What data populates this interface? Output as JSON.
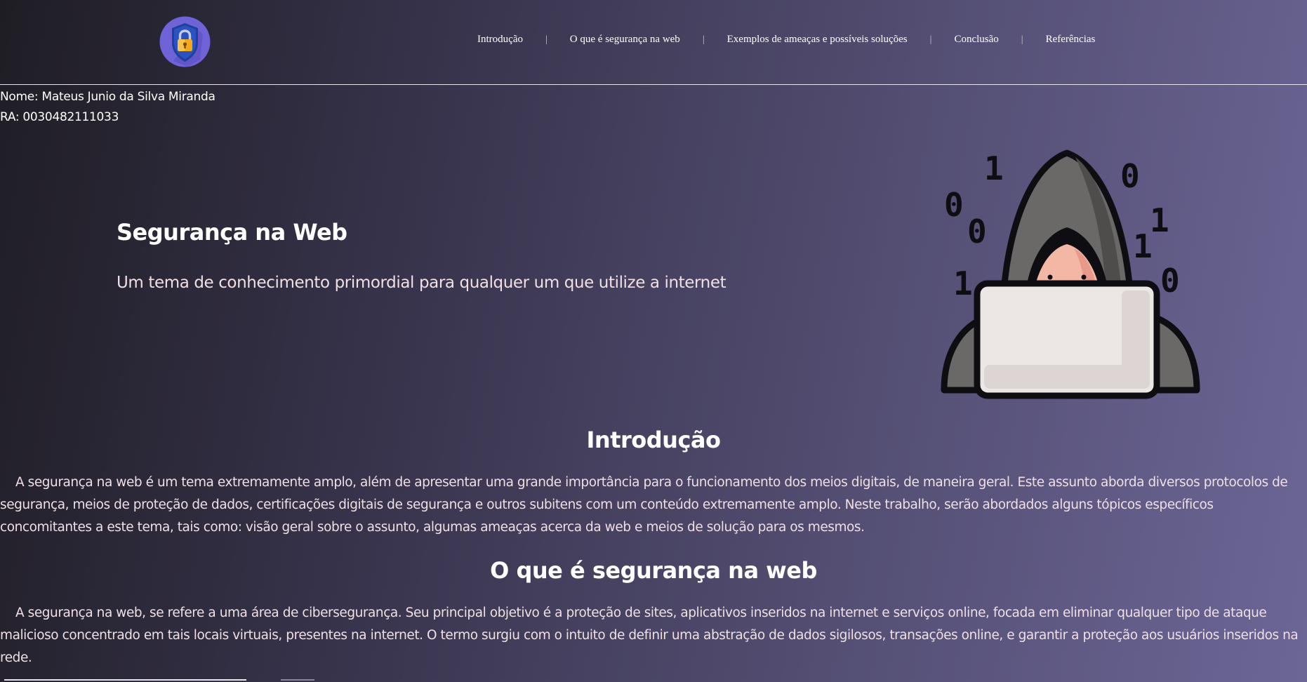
{
  "nav": {
    "items": [
      {
        "label": "Introdução"
      },
      {
        "label": "O que é segurança na web"
      },
      {
        "label": "Exemplos de ameaças e possíveis soluções"
      },
      {
        "label": "Conclusão"
      },
      {
        "label": "Referências"
      }
    ],
    "separator": "|"
  },
  "logo": {
    "icon": "padlock-shield-icon",
    "colors": {
      "circle": "#6f63d8",
      "shield": "#1f3f9a",
      "lock": "#f3a91a"
    }
  },
  "student": {
    "name": "Nome: Mateus Junio da Silva Miranda",
    "ra": "RA: 0030482111033"
  },
  "hero": {
    "title": "Segurança na Web",
    "subtitle": "Um tema de conhecimento primordial para qualquer um que utilize a internet",
    "illustration": "hacker-laptop-icon",
    "binary_digits": [
      "1",
      "0",
      "0",
      "0",
      "1",
      "1",
      "1",
      "0"
    ]
  },
  "sections": [
    {
      "title": "Introdução",
      "text": "A segurança na web é um tema extremamente amplo, além de apresentar uma grande importância para o funcionamento dos meios digitais, de maneira geral. Este assunto aborda diversos protocolos de segurança, meios de proteção de dados, certificações digitais de segurança e outros subitens com um conteúdo extremamente amplo. Neste trabalho, serão abordados alguns tópicos específicos concomitantes a este tema, tais como: visão geral sobre o assunto, algumas ameaças acerca da web e meios de solução para os mesmos."
    },
    {
      "title": "O que é segurança na web",
      "text": "A segurança na web, se refere a uma área de cibersegurança. Seu principal objetivo é a proteção de sites, aplicativos inseridos na internet e serviços online, focada em eliminar qualquer tipo de ataque malicioso concentrado em tais locais virtuais, presentes na internet. O termo surgiu com o intuito de definir uma abstração de dados sigilosos, transações online, e garantir a proteção aos usuários inseridos na rede."
    }
  ]
}
